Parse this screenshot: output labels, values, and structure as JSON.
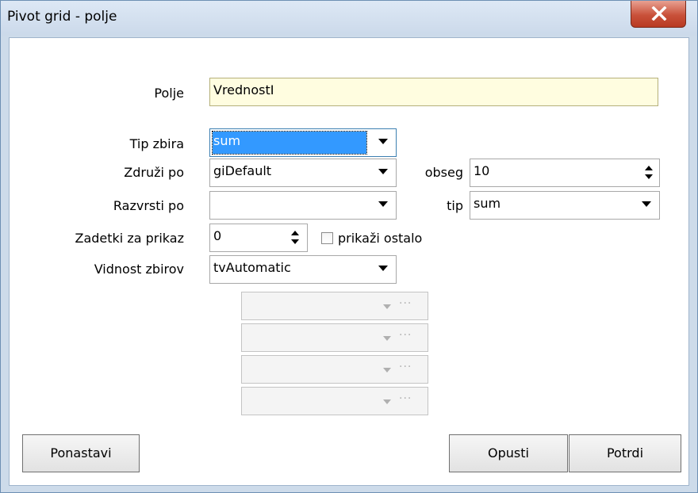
{
  "window": {
    "title": "Pivot grid - polje"
  },
  "form": {
    "polje": {
      "label": "Polje",
      "value": "VrednostI"
    },
    "tip_zbira": {
      "label": "Tip zbira",
      "value": "sum"
    },
    "zdruzi_po": {
      "label": "Združi po",
      "value": "giDefault"
    },
    "obseg": {
      "label": "obseg",
      "value": "10"
    },
    "razvrsti_po": {
      "label": "Razvrsti po",
      "value": ""
    },
    "tip": {
      "label": "tip",
      "value": "sum"
    },
    "zadetki": {
      "label": "Zadetki za prikaz",
      "value": "0"
    },
    "prikazi_ostalo": {
      "label": "prikaži ostalo",
      "checked": false
    },
    "vidnost": {
      "label": "Vidnost zbirov",
      "value": "tvAutomatic"
    },
    "disabled_dots": "···"
  },
  "buttons": {
    "reset": "Ponastavi",
    "cancel": "Opusti",
    "confirm": "Potrdi"
  }
}
